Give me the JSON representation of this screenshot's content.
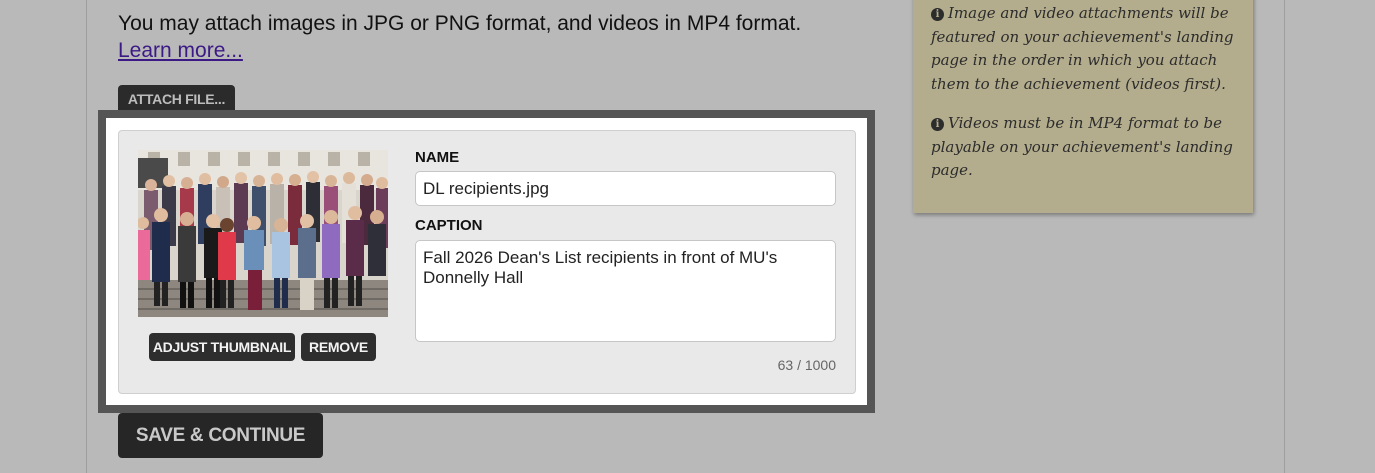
{
  "intro": {
    "text": "You may attach images in JPG or PNG format, and videos in MP4 format.",
    "link_label": "Learn more..."
  },
  "attach_button": {
    "label": "ATTACH FILE..."
  },
  "attachment": {
    "adjust_thumbnail_label": "ADJUST THUMBNAIL",
    "remove_label": "REMOVE",
    "name_label": "NAME",
    "name_value": "DL recipients.jpg",
    "caption_label": "CAPTION",
    "caption_value": "Fall 2026 Dean's List recipients in front of MU's Donnelly Hall",
    "char_count": "63 / 1000"
  },
  "save_button": {
    "label": "SAVE & CONTINUE"
  },
  "note": {
    "items": [
      "Image and video attachments will be featured on your achievement's landing page in the order in which you attach them to the achievement (videos first).",
      "Videos must be in MP4 format to be playable on your achievement's landing page."
    ]
  },
  "colors": {
    "page_background": "#b9b9b9",
    "highlight_border": "#555555",
    "note_background": "#b3ad8d",
    "link": "#3c1a86",
    "button_dark": "#2b2b2b"
  },
  "icons": {
    "note_item": "info-icon",
    "thumbnail": "group-photo"
  }
}
